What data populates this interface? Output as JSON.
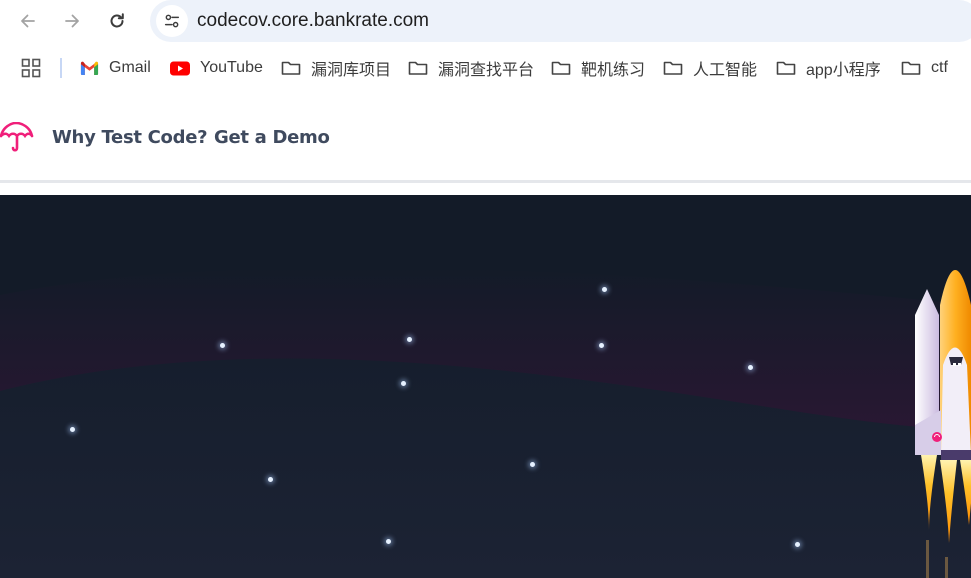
{
  "browser": {
    "url": "codecov.core.bankrate.com",
    "icons": {
      "back": "arrow-left-icon",
      "forward": "arrow-right-icon",
      "reload": "reload-icon",
      "site_info": "tune-icon",
      "apps": "apps-grid-icon"
    }
  },
  "bookmarks": [
    {
      "label": "Gmail",
      "icon": "gmail-icon"
    },
    {
      "label": "YouTube",
      "icon": "youtube-icon"
    },
    {
      "label": "漏洞库项目",
      "icon": "folder-icon"
    },
    {
      "label": "漏洞查找平台",
      "icon": "folder-icon"
    },
    {
      "label": "靶机练习",
      "icon": "folder-icon"
    },
    {
      "label": "人工智能",
      "icon": "folder-icon"
    },
    {
      "label": "app小程序",
      "icon": "folder-icon"
    },
    {
      "label": "ctf",
      "icon": "folder-icon"
    }
  ],
  "site": {
    "logo": "codecov-umbrella-logo",
    "nav": [
      "Why Test Code?",
      "Get a Demo"
    ]
  },
  "hero": {
    "illustration": "rocket-launch-illustration",
    "colors": {
      "sky": "#141c2b",
      "horizon_glow": "#3a1638",
      "accent": "#f01f7a",
      "flame": "#ffb020"
    }
  }
}
